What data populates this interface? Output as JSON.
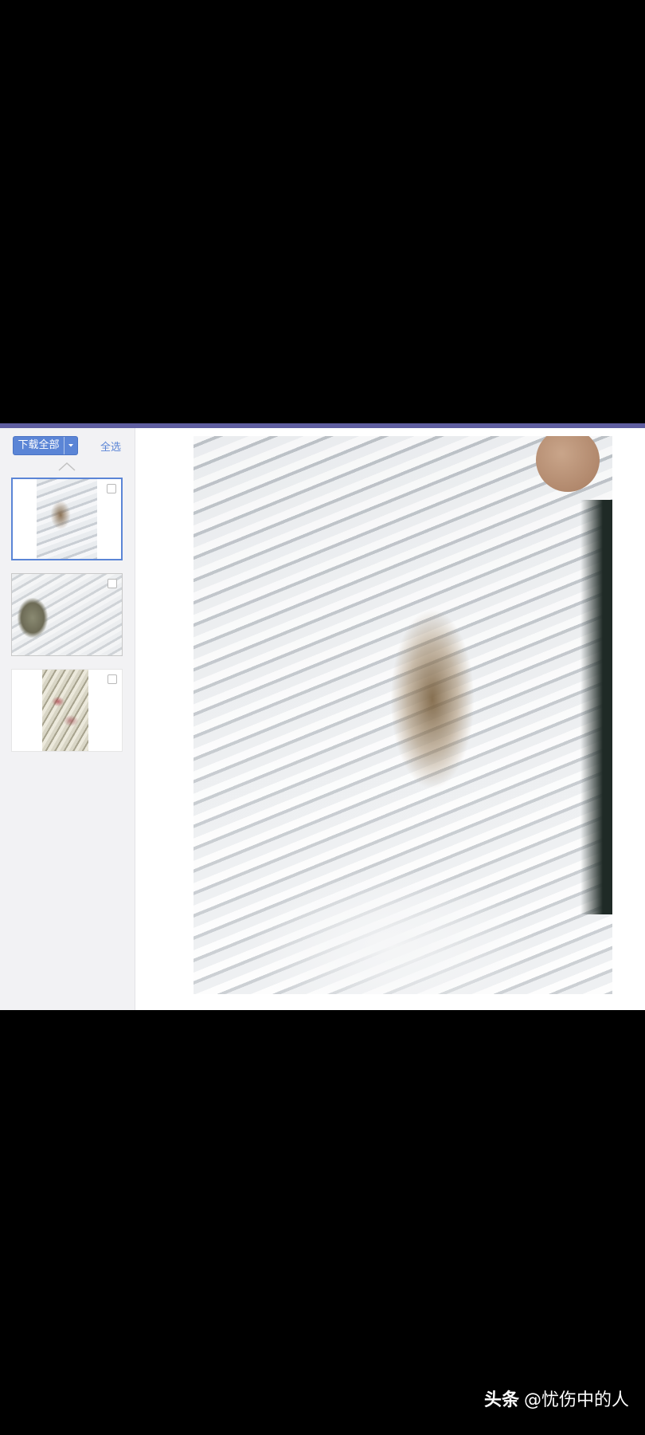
{
  "toolbar": {
    "download_all_label": "下载全部",
    "select_all_label": "全选"
  },
  "thumbnails": [
    {
      "selected": true,
      "checked": false
    },
    {
      "selected": false,
      "checked": false
    },
    {
      "selected": false,
      "checked": false
    }
  ],
  "watermark": {
    "brand": "头条",
    "author": "@忧伤中的人"
  },
  "colors": {
    "accent": "#5b85d6",
    "top_bar": "#5f5ea0",
    "sidebar_bg": "#f2f2f4",
    "background": "#000000"
  },
  "icons": [
    "dropdown-caret-icon",
    "chevron-up-icon",
    "checkbox-icon"
  ]
}
